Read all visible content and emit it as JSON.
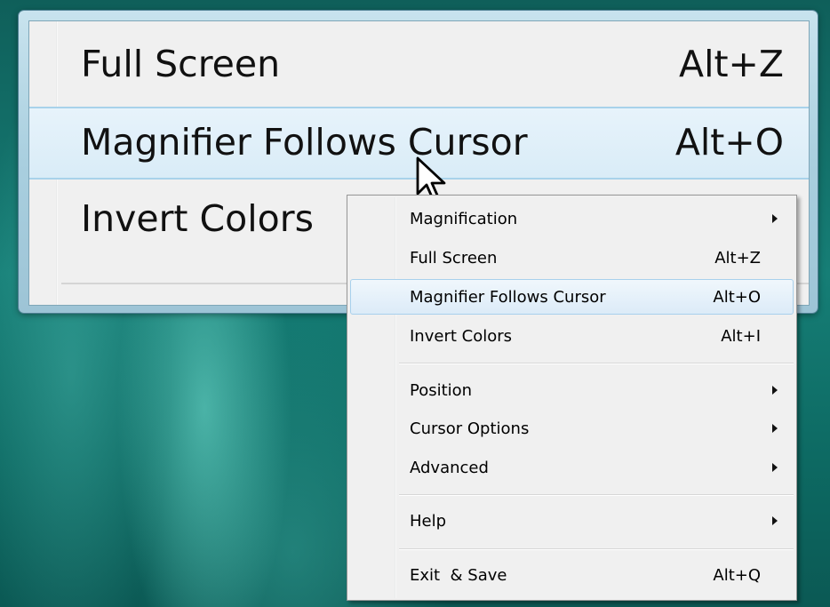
{
  "lens": {
    "items": [
      {
        "label": "Full Screen",
        "shortcut": "Alt+Z"
      },
      {
        "label": "Magnifier Follows Cursor",
        "shortcut": "Alt+O"
      },
      {
        "label": "Invert Colors",
        "shortcut": ""
      }
    ]
  },
  "context_menu": {
    "magnification": {
      "label": "Magnification",
      "submenu": true
    },
    "full_screen": {
      "label": "Full Screen",
      "shortcut": "Alt+Z"
    },
    "magnifier_follows_cursor": {
      "label": "Magnifier Follows Cursor",
      "shortcut": "Alt+O",
      "highlighted": true
    },
    "invert_colors": {
      "label": "Invert Colors",
      "shortcut": "Alt+I"
    },
    "position": {
      "label": "Position",
      "submenu": true
    },
    "cursor_options": {
      "label": "Cursor Options",
      "submenu": true
    },
    "advanced": {
      "label": "Advanced",
      "submenu": true
    },
    "help": {
      "label": "Help",
      "submenu": true
    },
    "exit_save": {
      "label": "Exit  & Save",
      "shortcut": "Alt+Q"
    }
  },
  "colors": {
    "desktop": "#167e76",
    "menu_background": "#f0f0f0",
    "highlight_border": "#a8d0ec",
    "lens_frame": "#a9cfdf"
  },
  "icons": {
    "cursor": "arrow-pointer-icon",
    "submenu": "submenu-arrow-icon"
  }
}
